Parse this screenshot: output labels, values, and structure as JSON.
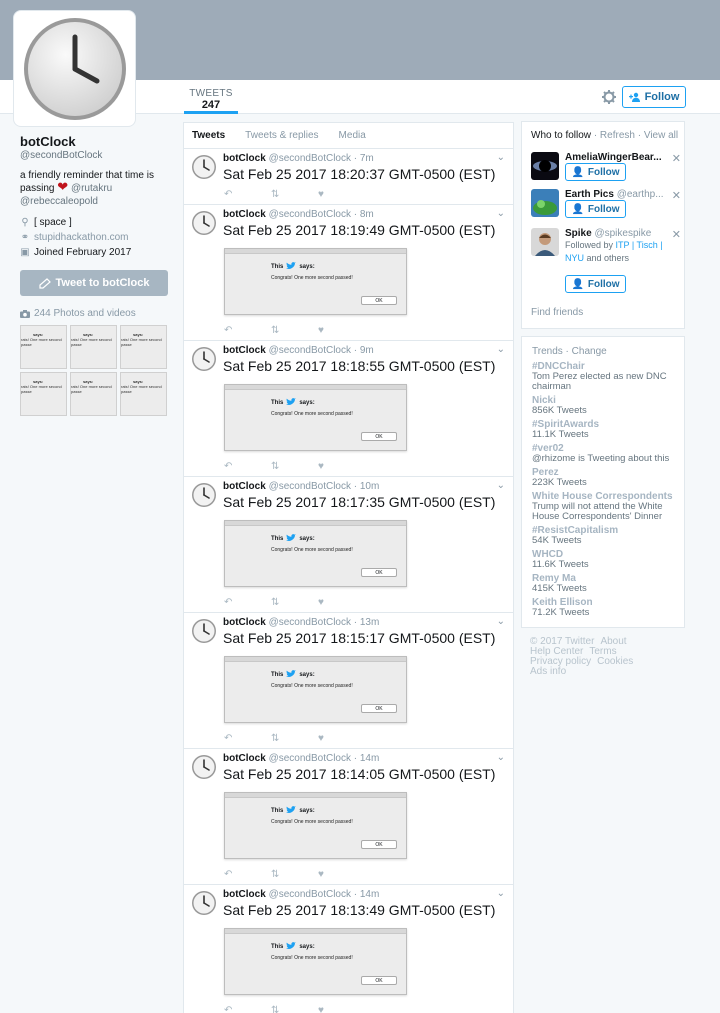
{
  "header": {
    "tweets_label": "TWEETS",
    "tweets_count": "247",
    "follow_label": "Follow"
  },
  "profile": {
    "name": "botClock",
    "handle": "@secondBotClock",
    "bio_text": "a friendly reminder that time is passing",
    "bio_mention1": "@rutakru",
    "bio_mention2": "@rebeccaleopold",
    "location": "[ space ]",
    "website": "stupidhackathon.com",
    "joined": "Joined February 2017",
    "tweet_to_label": "Tweet to botClock",
    "photos_label": "244 Photos and videos",
    "thumb_text1": "says:",
    "thumb_text2": "rats! One more second passe"
  },
  "timeline": {
    "tabs": [
      "Tweets",
      "Tweets & replies",
      "Media"
    ],
    "tweets": [
      {
        "name": "botClock",
        "handle": "@secondBotClock",
        "time": "7m",
        "text": "Sat Feb 25 2017 18:20:37 GMT-0500 (EST)"
      },
      {
        "name": "botClock",
        "handle": "@secondBotClock",
        "time": "8m",
        "text": "Sat Feb 25 2017 18:19:49 GMT-0500 (EST)"
      },
      {
        "name": "botClock",
        "handle": "@secondBotClock",
        "time": "9m",
        "text": "Sat Feb 25 2017 18:18:55 GMT-0500 (EST)"
      },
      {
        "name": "botClock",
        "handle": "@secondBotClock",
        "time": "10m",
        "text": "Sat Feb 25 2017 18:17:35 GMT-0500 (EST)"
      },
      {
        "name": "botClock",
        "handle": "@secondBotClock",
        "time": "13m",
        "text": "Sat Feb 25 2017 18:15:17 GMT-0500 (EST)"
      },
      {
        "name": "botClock",
        "handle": "@secondBotClock",
        "time": "14m",
        "text": "Sat Feb 25 2017 18:14:05 GMT-0500 (EST)"
      },
      {
        "name": "botClock",
        "handle": "@secondBotClock",
        "time": "14m",
        "text": "Sat Feb 25 2017 18:13:49 GMT-0500 (EST)"
      }
    ],
    "dialog": {
      "this": "This",
      "says": "says:",
      "message": "Congrats! One more second passed!",
      "ok": "OK"
    }
  },
  "who_to_follow": {
    "title": "Who to follow",
    "refresh": "Refresh",
    "view_all": "View all",
    "suggestions": [
      {
        "name": "AmeliaWingerBear...",
        "handle": ""
      },
      {
        "name": "Earth Pics",
        "handle": "@earthp..."
      },
      {
        "name": "Spike",
        "handle": "@spikespike",
        "sub1": "Followed by",
        "sub2": "ITP | Tisch | NYU",
        "sub3": "and others"
      }
    ],
    "follow_label": "Follow",
    "find_friends": "Find friends"
  },
  "trends": {
    "title": "Trends",
    "change": "Change",
    "items": [
      {
        "name": "#DNCChair",
        "desc": "Tom Perez elected as new DNC chairman"
      },
      {
        "name": "Nicki",
        "desc": "856K Tweets"
      },
      {
        "name": "#SpiritAwards",
        "desc": "11.1K Tweets"
      },
      {
        "name": "#ver02",
        "desc": "@rhizome is Tweeting about this"
      },
      {
        "name": "Perez",
        "desc": "223K Tweets"
      },
      {
        "name": "White House Correspondents",
        "desc": "Trump will not attend the White House Correspondents' Dinner"
      },
      {
        "name": "#ResistCapitalism",
        "desc": "54K Tweets"
      },
      {
        "name": "WHCD",
        "desc": "11.6K Tweets"
      },
      {
        "name": "Remy Ma",
        "desc": "415K Tweets"
      },
      {
        "name": "Keith Ellison",
        "desc": "71.2K Tweets"
      }
    ]
  },
  "footer": {
    "links": [
      "© 2017 Twitter",
      "About",
      "Help Center",
      "Terms",
      "Privacy policy",
      "Cookies",
      "Ads info"
    ]
  },
  "colors": {
    "banner": "#9eabb8",
    "accent": "#1da1f2",
    "heart": "#c0141c"
  }
}
